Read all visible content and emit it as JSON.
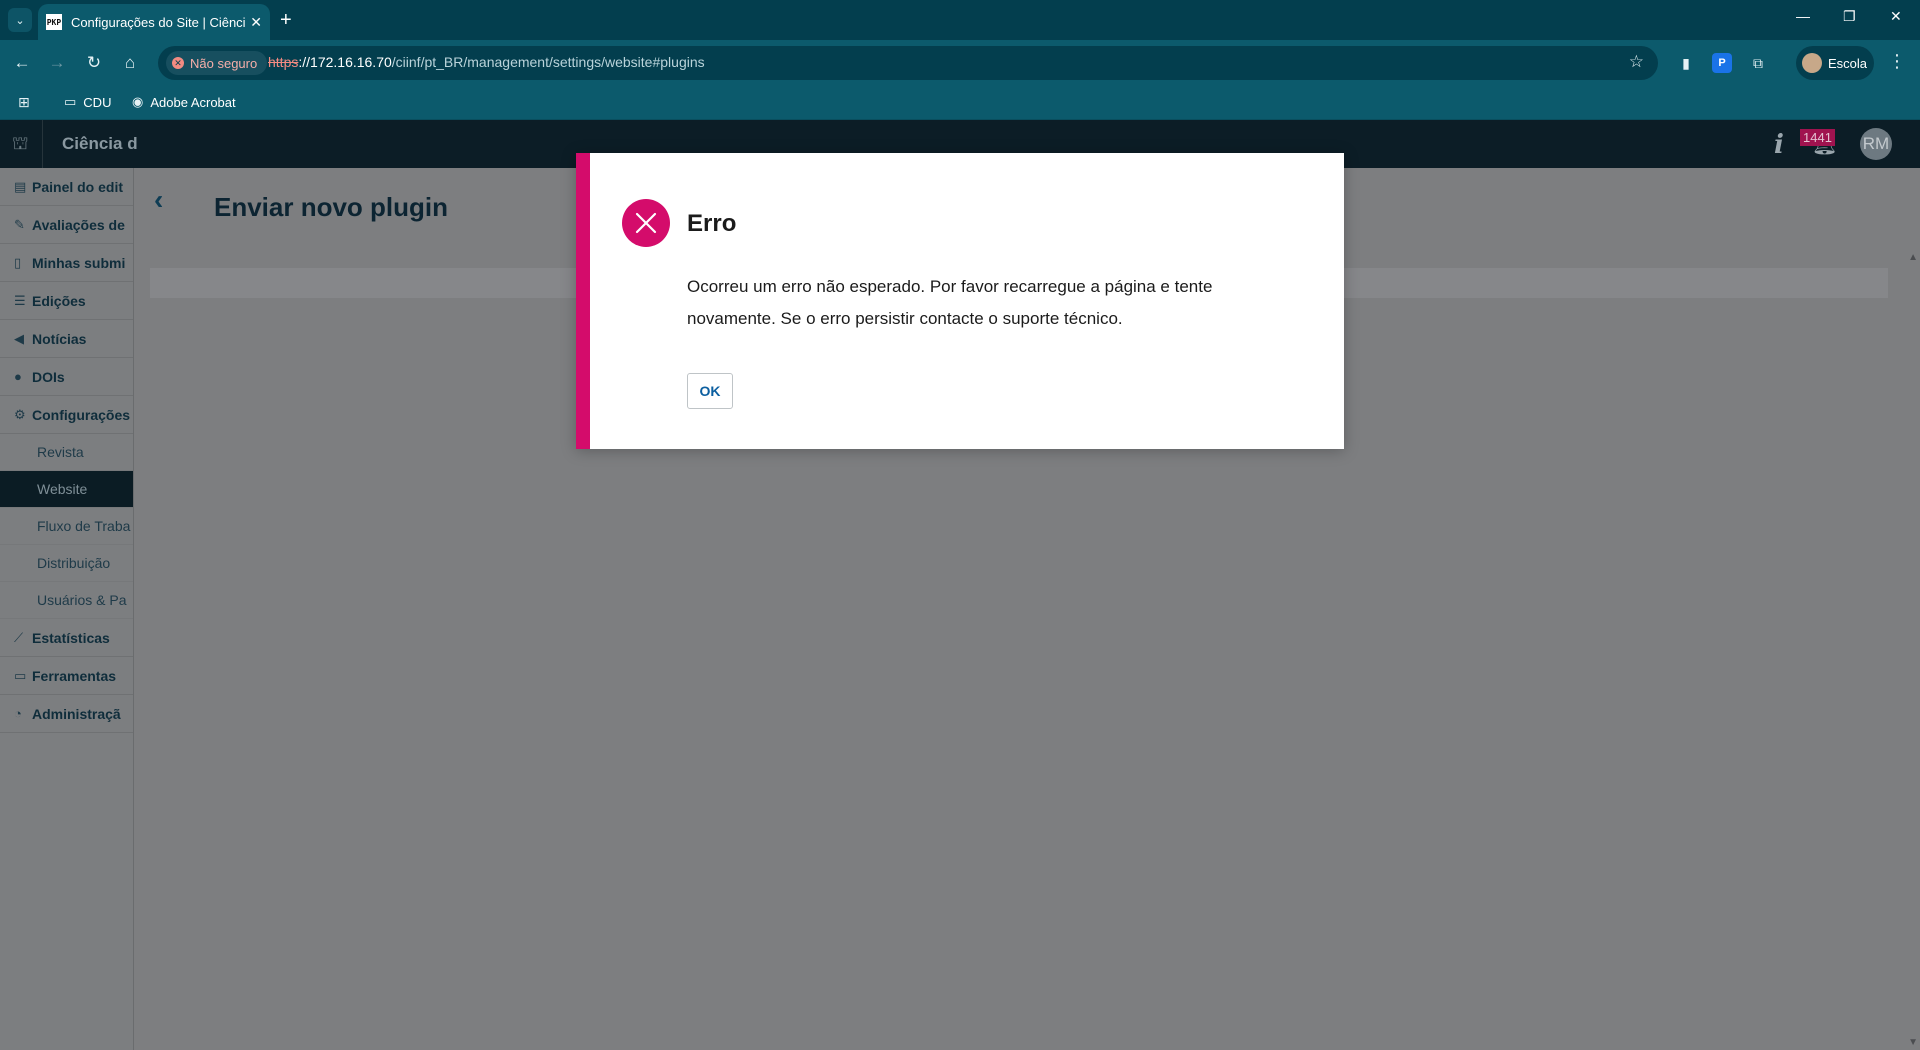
{
  "browser": {
    "tab": {
      "favicon": "PKP",
      "title": "Configurações do Site | Ciência",
      "close": "✕"
    },
    "new_tab": "+",
    "window": {
      "minimize": "—",
      "restore": "❐",
      "close": "✕"
    },
    "security_chip": "Não seguro",
    "url": {
      "scheme": "https",
      "host": "://172.16.16.70",
      "path": "/ciinf/pt_BR/management/settings/website#plugins"
    },
    "profile_name": "Escola",
    "bookmarks": [
      {
        "label": "CDU",
        "icon": "folder-icon"
      },
      {
        "label": "Adobe Acrobat",
        "icon": "acrobat-icon"
      }
    ]
  },
  "app": {
    "journal_name": "Ciência d",
    "notifications_count": "1441",
    "user_initials": "RM"
  },
  "sidebar": {
    "items": [
      {
        "label": "Painel do edit",
        "icon": "dashboard-icon"
      },
      {
        "label": "Avaliações de",
        "icon": "review-icon"
      },
      {
        "label": "Minhas submi",
        "icon": "submissions-icon"
      },
      {
        "label": "Edições",
        "icon": "issues-icon"
      },
      {
        "label": "Notícias",
        "icon": "megaphone-icon"
      },
      {
        "label": "DOIs",
        "icon": "doi-icon"
      },
      {
        "label": "Configurações",
        "icon": "gear-icon"
      }
    ],
    "sub_items": [
      {
        "label": "Revista"
      },
      {
        "label": "Website"
      },
      {
        "label": "Fluxo de Traba"
      },
      {
        "label": "Distribuição"
      },
      {
        "label": "Usuários & Pa"
      }
    ],
    "bottom_items": [
      {
        "label": "Estatísticas",
        "icon": "chart-icon"
      },
      {
        "label": "Ferramentas",
        "icon": "toolbox-icon"
      },
      {
        "label": "Administraçã",
        "icon": "admin-icon"
      }
    ]
  },
  "main": {
    "page_title": "Enviar novo plugin"
  },
  "modal": {
    "title": "Erro",
    "message": "Ocorreu um erro não esperado. Por favor recarregue a página e tente novamente. Se o erro persistir contacte o suporte técnico.",
    "ok_label": "OK"
  },
  "colors": {
    "error_accent": "#d40c6b",
    "chrome_dark": "#033e4e",
    "chrome_toolbar": "#0c5a6c",
    "app_header": "#0c1d26"
  }
}
